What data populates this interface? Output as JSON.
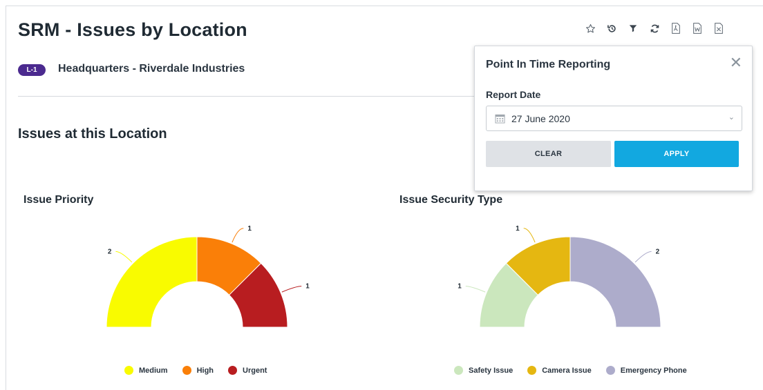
{
  "page": {
    "title": "SRM - Issues by Location",
    "location_badge": "L-1",
    "location_name": "Headquarters - Riverdale Industries",
    "section_title": "Issues at this Location"
  },
  "toolbar": {
    "icons": [
      "star-icon",
      "history-icon",
      "filter-icon",
      "refresh-icon",
      "pdf-export-icon",
      "word-export-icon",
      "excel-export-icon"
    ]
  },
  "point_in_time_panel": {
    "title": "Point In Time Reporting",
    "close_glyph": "✕",
    "report_date_label": "Report Date",
    "report_date_value": "27 June 2020",
    "clear_label": "CLEAR",
    "apply_label": "APPLY"
  },
  "chart_data": [
    {
      "type": "pie",
      "title": "Issue Priority",
      "variant": "half-donut",
      "categories": [
        "Medium",
        "High",
        "Urgent"
      ],
      "values": [
        2,
        1,
        1
      ],
      "colors": [
        "#f9fb00",
        "#fa7f08",
        "#b81d20"
      ],
      "legend_position": "bottom"
    },
    {
      "type": "pie",
      "title": "Issue Security Type",
      "variant": "half-donut",
      "categories": [
        "Safety Issue",
        "Camera Issue",
        "Emergency Phone"
      ],
      "values": [
        1,
        1,
        2
      ],
      "colors": [
        "#cbe7bd",
        "#e5b711",
        "#adaccb"
      ],
      "legend_position": "bottom"
    }
  ],
  "colors": {
    "badge": "#4b2a8f",
    "apply_button": "#12a8e0",
    "clear_button": "#dfe2e6"
  }
}
